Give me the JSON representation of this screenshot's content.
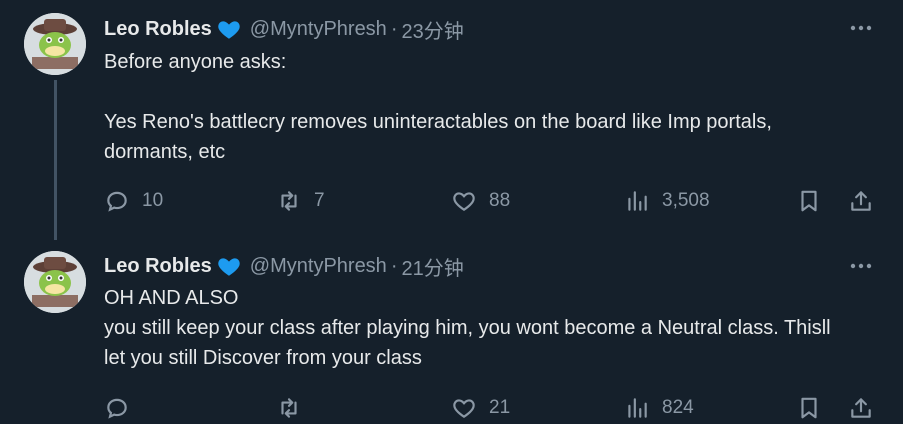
{
  "tweets": [
    {
      "name": "Leo Robles",
      "handle": "@MyntyPhresh",
      "time": "23分钟",
      "text": "Before anyone asks:\n\nYes Reno's battlecry removes uninteractables on the board like Imp portals, dormants, etc",
      "replies": "10",
      "retweets": "7",
      "likes": "88",
      "views": "3,508"
    },
    {
      "name": "Leo Robles",
      "handle": "@MyntyPhresh",
      "time": "21分钟",
      "text": "OH AND ALSO\nyou still keep your class after playing him, you wont become a Neutral class. Thisll let you still Discover from your class",
      "replies": "",
      "retweets": "",
      "likes": "21",
      "views": "824"
    }
  ],
  "separator": "·",
  "colors": {
    "background": "#15202b",
    "text": "#e7e9ea",
    "muted": "#8b98a5",
    "verified": "#1d9bf0",
    "thread_line": "#425364"
  },
  "icons": [
    "verified-heart-icon",
    "more-icon",
    "reply-icon",
    "retweet-icon",
    "like-icon",
    "views-icon",
    "bookmark-icon",
    "share-icon"
  ]
}
